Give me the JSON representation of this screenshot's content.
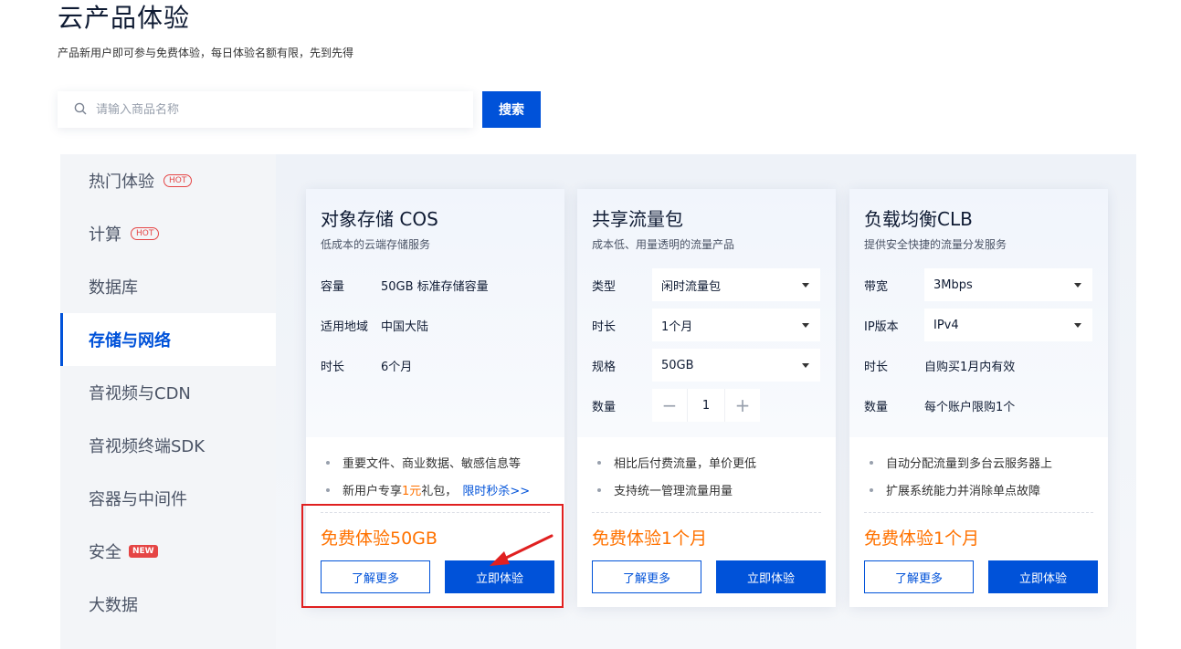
{
  "header": {
    "title": "云产品体验",
    "subtitle": "产品新用户即可参与免费体验，每日体验名额有限，先到先得"
  },
  "search": {
    "placeholder": "请输入商品名称",
    "value": "",
    "button_label": "搜索"
  },
  "sidebar": {
    "items": [
      {
        "label": "热门体验",
        "badge": "HOT"
      },
      {
        "label": "计算",
        "badge": "HOT"
      },
      {
        "label": "数据库",
        "badge": ""
      },
      {
        "label": "存储与网络",
        "badge": "",
        "active": true
      },
      {
        "label": "音视频与CDN",
        "badge": ""
      },
      {
        "label": "音视频终端SDK",
        "badge": ""
      },
      {
        "label": "容器与中间件",
        "badge": ""
      },
      {
        "label": "安全",
        "badge": "NEW"
      },
      {
        "label": "大数据",
        "badge": ""
      }
    ]
  },
  "cards": [
    {
      "title": "对象存储 COS",
      "desc": "低成本的云端存储服务",
      "specs": [
        {
          "label": "容量",
          "value": "50GB 标准存储容量"
        },
        {
          "label": "适用地域",
          "value": "中国大陆"
        },
        {
          "label": "时长",
          "value": "6个月"
        }
      ],
      "features": [
        "重要文件、商业数据、敏感信息等"
      ],
      "promo": {
        "prefix": "新用户专享",
        "amount": "1元",
        "suffix": " 礼包，",
        "link": "限时秒杀>>"
      },
      "price": "免费体验50GB",
      "more_label": "了解更多",
      "try_label": "立即体验"
    },
    {
      "title": "共享流量包",
      "desc": "成本低、用量透明的流量产品",
      "specs": [
        {
          "label": "类型",
          "value": "闲时流量包"
        },
        {
          "label": "时长",
          "value": "1个月"
        },
        {
          "label": "规格",
          "value": "50GB"
        },
        {
          "label": "数量",
          "value": "1"
        }
      ],
      "features": [
        "相比后付费流量，单价更低",
        "支持统一管理流量用量"
      ],
      "price": "免费体验1个月",
      "more_label": "了解更多",
      "try_label": "立即体验"
    },
    {
      "title": "负载均衡CLB",
      "desc": "提供安全快捷的流量分发服务",
      "specs": [
        {
          "label": "带宽",
          "value": "3Mbps"
        },
        {
          "label": "IP版本",
          "value": "IPv4"
        },
        {
          "label": "时长",
          "value": "自购买1月内有效"
        },
        {
          "label": "数量",
          "value": "每个账户限购1个"
        }
      ],
      "features": [
        "自动分配流量到多台云服务器上",
        "扩展系统能力并消除单点故障"
      ],
      "price": "免费体验1个月",
      "more_label": "了解更多",
      "try_label": "立即体验"
    }
  ],
  "colors": {
    "brand": "#0052d9",
    "price": "#ff7200",
    "badge": "#e54545",
    "annotation": "#e02020"
  },
  "icons": {
    "search": "search-icon",
    "dropdown": "chevron-down-icon",
    "minus": "minus-icon",
    "plus": "plus-icon"
  }
}
